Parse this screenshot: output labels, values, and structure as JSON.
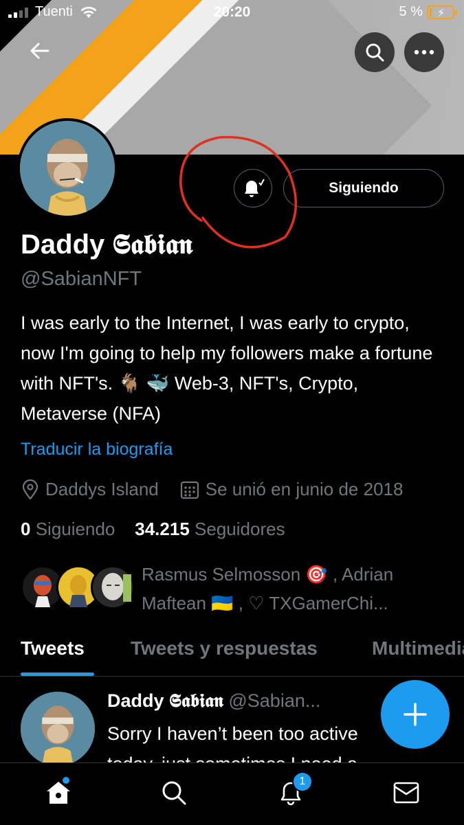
{
  "status_bar": {
    "carrier": "Tuenti",
    "time": "20:20",
    "battery_percent": "5 %",
    "battery_level": 0.05
  },
  "profile": {
    "display_name": "Daddy 𝕾𝖆𝖇𝖎𝖆𝖓",
    "handle": "@SabianNFT",
    "bio": "I was early to the Internet, I was early to crypto, now I'm going to help my followers make a fortune with NFT's. 🐐 🐳 Web-3, NFT's, Crypto, Metaverse (NFA)",
    "translate_label": "Traducir la biografía",
    "location": "Daddys Island",
    "joined": "Se unió en junio de 2018",
    "following_count": "0",
    "following_label": "Siguiendo",
    "followers_count": "34.215",
    "followers_label": "Seguidores",
    "followed_by": "Rasmus Selmosson 🎯 , Adrian Maftean 🇺🇦 , ♡ TXGamerChi...",
    "follow_button_label": "Siguiendo"
  },
  "tabs": [
    {
      "label": "Tweets",
      "active": true
    },
    {
      "label": "Tweets y respuestas",
      "active": false
    },
    {
      "label": "Multimedia",
      "active": false
    }
  ],
  "tweet": {
    "name": "Daddy 𝕾𝖆𝖇𝖎𝖆𝖓",
    "handle": "@Sabian...",
    "text": "Sorry I haven’t been too active today, just sometimes I need a"
  },
  "bottom_nav": {
    "notifications_badge": "1",
    "items": [
      "home-icon",
      "search-icon",
      "notifications-icon",
      "messages-icon"
    ]
  },
  "colors": {
    "accent": "#1d9bf0",
    "annotation_red": "#e0301e",
    "banner_orange": "#f4a21a"
  }
}
